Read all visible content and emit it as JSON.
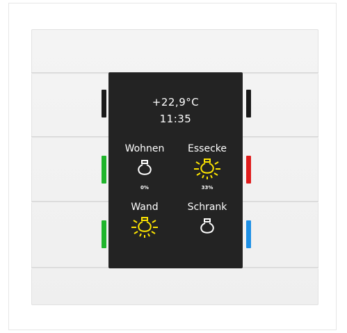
{
  "display": {
    "temperature": "+22,9°C",
    "time": "11:35",
    "loads": [
      {
        "label": "Wohnen",
        "state": "off",
        "percent": "0%",
        "icon": "bulb-off-icon"
      },
      {
        "label": "Essecke",
        "state": "on",
        "percent": "33%",
        "icon": "bulb-on-icon"
      },
      {
        "label": "Wand",
        "state": "on",
        "percent": "",
        "icon": "bulb-on-icon"
      },
      {
        "label": "Schrank",
        "state": "off",
        "percent": "",
        "icon": "bulb-off-icon"
      }
    ]
  },
  "leds": {
    "left_top": "#1a1a1a",
    "left_middle": "#1fb52b",
    "left_bottom": "#1fb52b",
    "right_top": "#1a1a1a",
    "right_middle": "#e01c1c",
    "right_bottom": "#1e90e6"
  },
  "colors": {
    "display_bg": "#232323",
    "bulb_on": "#ffe600",
    "bulb_off": "#ffffff"
  }
}
